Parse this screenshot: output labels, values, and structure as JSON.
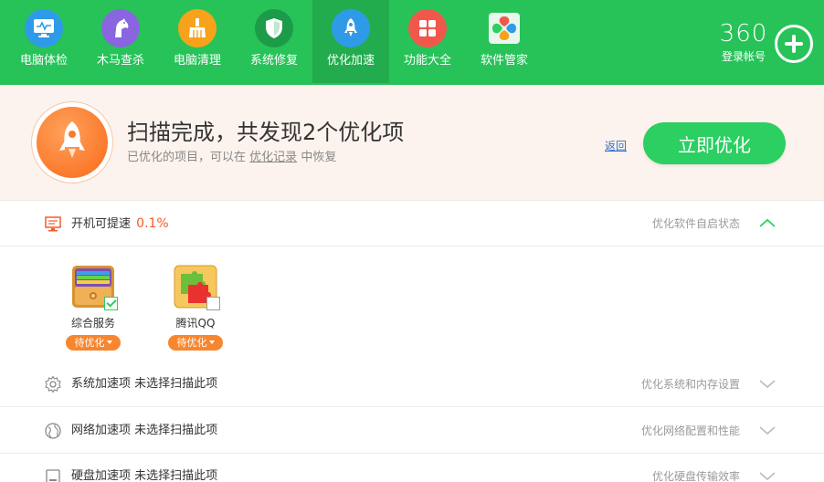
{
  "nav": {
    "items": [
      {
        "label": "电脑体检",
        "icon": "monitor-checkup-icon",
        "color": "#2f9be8"
      },
      {
        "label": "木马查杀",
        "icon": "horse-icon",
        "color": "#8a65e0"
      },
      {
        "label": "电脑清理",
        "icon": "broom-icon",
        "color": "#f7a21b"
      },
      {
        "label": "系统修复",
        "icon": "shield-icon",
        "color": "#1c9b48"
      },
      {
        "label": "优化加速",
        "icon": "rocket-icon",
        "color": "#2f9be8",
        "active": true
      },
      {
        "label": "功能大全",
        "icon": "grid-icon",
        "color": "#f0584b"
      },
      {
        "label": "软件管家",
        "icon": "software-manager-icon",
        "color": "#f0f0f0"
      }
    ]
  },
  "brand": {
    "logo": "360",
    "login": "登录帐号"
  },
  "banner": {
    "title": "扫描完成，共发现2个优化项",
    "subtitle_prefix": "已优化的项目，可以在",
    "subtitle_link": "优化记录",
    "subtitle_suffix": "中恢复",
    "back_link": "返回",
    "optimize_button": "立即优化"
  },
  "sections": {
    "startup": {
      "title": "开机可提速",
      "percent": "0.1%",
      "right": "优化软件自启状态",
      "expanded": true,
      "items": [
        {
          "name": "综合服务",
          "status": "待优化",
          "checked": true
        },
        {
          "name": "腾讯QQ",
          "status": "待优化",
          "checked": false
        }
      ]
    },
    "system": {
      "title": "系统加速项",
      "note": "未选择扫描此项",
      "right": "优化系统和内存设置"
    },
    "network": {
      "title": "网络加速项",
      "note": "未选择扫描此项",
      "right": "优化网络配置和性能"
    },
    "disk": {
      "title": "硬盘加速项",
      "note": "未选择扫描此项",
      "right": "优化硬盘传输效率"
    }
  },
  "colors": {
    "brand_green": "#27c359",
    "accent_orange": "#f7862f",
    "percent_red": "#f45a2a"
  }
}
